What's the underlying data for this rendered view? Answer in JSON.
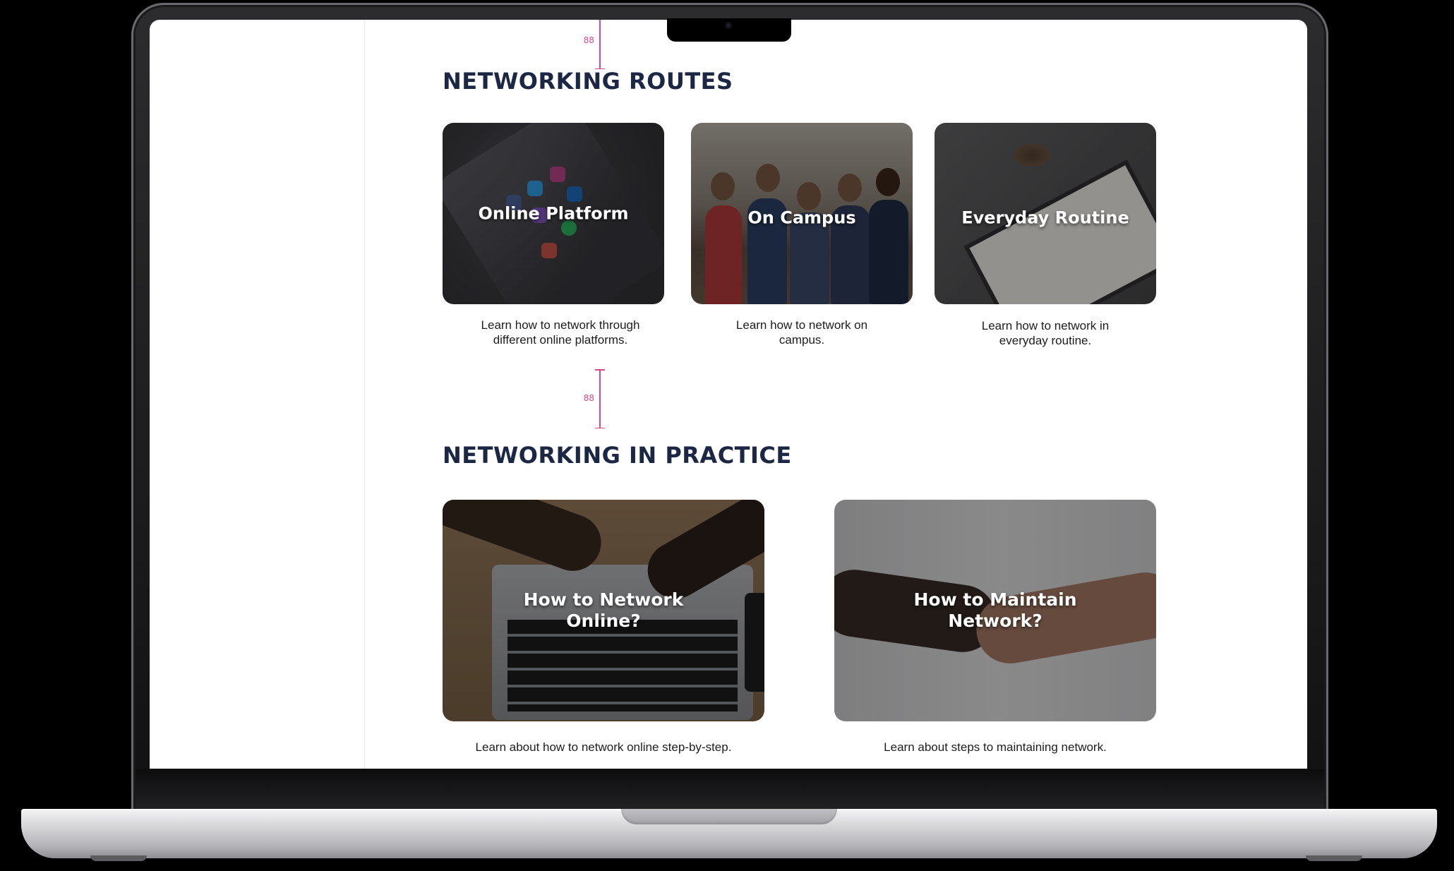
{
  "routes": {
    "spacer_label": "88",
    "title": "NETWORKING ROUTES",
    "cards": [
      {
        "title": "Online Platform",
        "caption": "Learn how to network through\ndifferent online platforms."
      },
      {
        "title": "On Campus",
        "caption": "Learn how to network on\ncampus."
      },
      {
        "title": "Everyday Routine",
        "caption": "Learn how to network in\neveryday routine."
      }
    ]
  },
  "practice": {
    "spacer_label": "88",
    "title": "NETWORKING IN PRACTICE",
    "cards": [
      {
        "title": "How to Network\nOnline?",
        "caption": "Learn about how to network online step-by-step."
      },
      {
        "title": "How to Maintain\nNetwork?",
        "caption": "Learn about steps to maintaining network."
      }
    ]
  },
  "colors": {
    "heading": "#1b2744",
    "spacer_annotation": "#d6488c",
    "card_overlay": "rgba(0,0,0,0.45)"
  },
  "icons": [
    "camera-icon"
  ]
}
